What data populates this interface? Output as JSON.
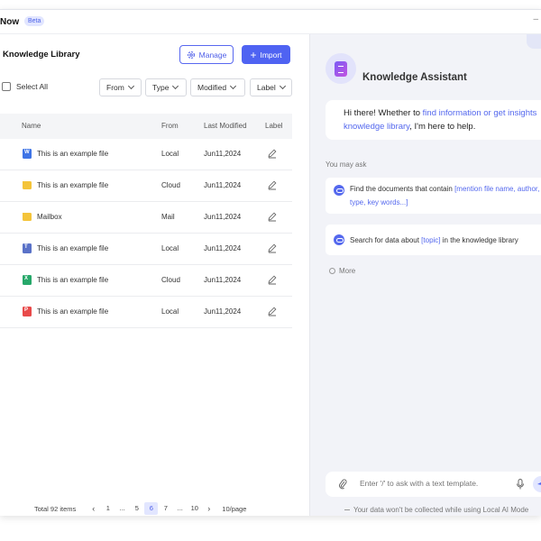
{
  "app": {
    "name": "Now",
    "badge": "Beta",
    "minimize": "–"
  },
  "library": {
    "title": "Knowledge Library",
    "manage_label": "Manage",
    "import_label": "Import",
    "select_all": "Select All",
    "filters": [
      "From",
      "Type",
      "Modified",
      "Label"
    ],
    "columns": {
      "name": "Name",
      "from": "From",
      "modified": "Last Modified",
      "label": "Label"
    },
    "rows": [
      {
        "name": "This is an example file",
        "from": "Local",
        "modified": "Jun11,2024",
        "icon": "word-doc-icon"
      },
      {
        "name": "This is an example file",
        "from": "Cloud",
        "modified": "Jun11,2024",
        "icon": "folder-icon"
      },
      {
        "name": "Mailbox",
        "from": "Mail",
        "modified": "Jun11,2024",
        "icon": "folder-icon"
      },
      {
        "name": "This is an example file",
        "from": "Local",
        "modified": "Jun11,2024",
        "icon": "doc-icon"
      },
      {
        "name": "This is an example file",
        "from": "Cloud",
        "modified": "Jun11,2024",
        "icon": "sheet-icon"
      },
      {
        "name": "This is an example file",
        "from": "Local",
        "modified": "Jun11,2024",
        "icon": "pdf-icon"
      }
    ],
    "pagination": {
      "total": "Total 92 items",
      "prev": "‹",
      "pages": [
        "1",
        "...",
        "5",
        "6",
        "7",
        "...",
        "10"
      ],
      "current": "6",
      "next": "›",
      "per_page": "10/page"
    }
  },
  "assistant": {
    "title": "Knowledge Assistant",
    "greeting_pre": "Hi there!  Whether to ",
    "greeting_link": "find information or get insights",
    "greeting_link2": "knowledge library",
    "greeting_post": ", I'm here to help.",
    "may_ask": "You may ask",
    "suggestion1_pre": "Find the documents that contain ",
    "suggestion1_link": "[mention file name, author,",
    "suggestion1_link2": "type, key words...]",
    "suggestion2_pre": "Search for data about ",
    "suggestion2_link": "[topic]",
    "suggestion2_post": " in the knowledge library",
    "more": "More",
    "input_placeholder": "Enter '/' to ask with a text template.",
    "disclaimer": "Your data won't be collected while using   Local AI Mode"
  },
  "colors": {
    "accent": "#4f63f2",
    "badge_bg": "#e2e6ff",
    "panel_bg": "#f2f3f8"
  }
}
